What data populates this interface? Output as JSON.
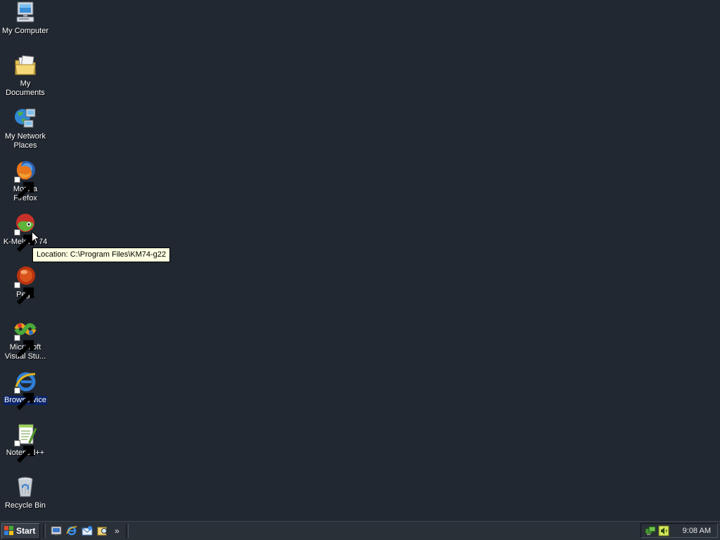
{
  "desktop": {
    "icons": [
      {
        "label": "My Computer",
        "icon": "computer-icon",
        "shortcut": false
      },
      {
        "label": "My Documents",
        "icon": "documents-folder-icon",
        "shortcut": false
      },
      {
        "label": "My Network Places",
        "icon": "network-places-icon",
        "shortcut": false
      },
      {
        "label": "Mozilla Firefox",
        "icon": "firefox-icon",
        "shortcut": true
      },
      {
        "label": "K-Meleon 74",
        "icon": "kmeleon-icon",
        "shortcut": true
      },
      {
        "label": "Pego",
        "icon": "pego-icon",
        "shortcut": true
      },
      {
        "label": "Microsoft Visual Stu...",
        "icon": "visual-studio-icon",
        "shortcut": true
      },
      {
        "label": "Browservice",
        "icon": "internet-explorer-icon",
        "shortcut": true,
        "selected": true
      },
      {
        "label": "Notepad++",
        "icon": "notepad-plus-plus-icon",
        "shortcut": true
      },
      {
        "label": "Recycle Bin",
        "icon": "recycle-bin-icon",
        "shortcut": false
      }
    ]
  },
  "tooltip": {
    "text": "Location: C:\\Program Files\\KM74-g22"
  },
  "taskbar": {
    "start_label": "Start",
    "quick_launch": [
      "show-desktop-icon",
      "internet-explorer-icon",
      "outlook-express-icon",
      "search-icon"
    ],
    "more_label": "»",
    "tray_icons": [
      "network-tray-icon",
      "volume-tray-icon"
    ],
    "clock": "9:08 AM"
  },
  "colors": {
    "desktop_bg": "#222831",
    "taskbar_bg": "#2a3038",
    "tooltip_bg": "#ffffe1",
    "selection": "#0a246a"
  }
}
